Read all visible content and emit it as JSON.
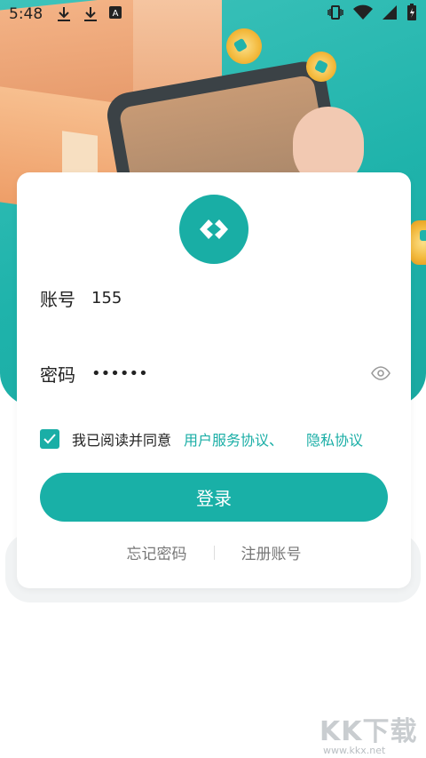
{
  "status_bar": {
    "time": "5:48",
    "left_icons": [
      "download-icon",
      "download-icon",
      "keyboard-a-icon"
    ],
    "right_icons": [
      "vibrate-icon",
      "wifi-icon",
      "signal-icon",
      "battery-charging-icon"
    ]
  },
  "login_form": {
    "account_label": "账号",
    "account_value": "155",
    "password_label": "密码",
    "password_value": "••••••",
    "agreement": {
      "checked": true,
      "text": "我已阅读并同意",
      "terms_link": "用户服务协议、",
      "privacy_link": "隐私协议"
    },
    "login_button": "登录",
    "forgot_password": "忘记密码",
    "register": "注册账号"
  },
  "watermark": {
    "main": "KK下载",
    "sub": "www.kkx.net"
  },
  "colors": {
    "accent": "#19b0a7",
    "text": "#222222",
    "muted": "#777777"
  }
}
